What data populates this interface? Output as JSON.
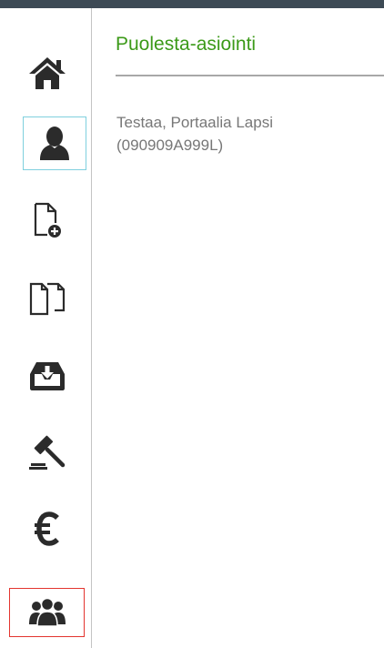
{
  "header": {
    "title": "Puolesta-asiointi"
  },
  "person": {
    "name": "Testaa, Portaalia Lapsi",
    "id": "(090909A999L)"
  },
  "sidebar": {
    "items": [
      {
        "icon": "home-icon"
      },
      {
        "icon": "user-icon",
        "state": "selected"
      },
      {
        "icon": "new-document-icon"
      },
      {
        "icon": "documents-icon"
      },
      {
        "icon": "inbox-download-icon"
      },
      {
        "icon": "gavel-icon"
      },
      {
        "icon": "euro-icon"
      },
      {
        "icon": "group-icon",
        "state": "focused"
      }
    ]
  },
  "colors": {
    "title": "#3c9a19",
    "icon": "#2b2b2b",
    "topbar": "#3d4a55",
    "selected_border": "#7fd0de",
    "focused_border": "#e3342f"
  }
}
